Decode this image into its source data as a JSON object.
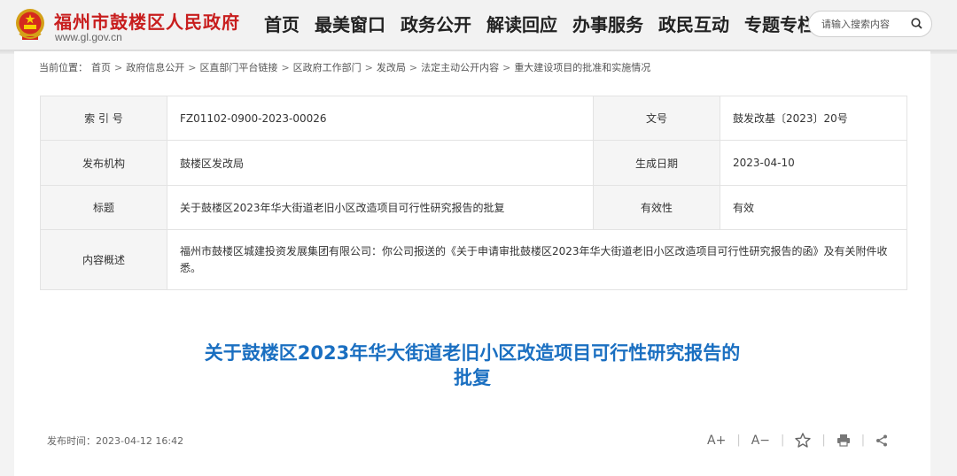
{
  "site": {
    "title": "福州市鼓楼区人民政府",
    "url": "www.gl.gov.cn"
  },
  "nav": [
    {
      "label": "首页"
    },
    {
      "label": "最美窗口"
    },
    {
      "label": "政务公开"
    },
    {
      "label": "解读回应"
    },
    {
      "label": "办事服务"
    },
    {
      "label": "政民互动"
    },
    {
      "label": "专题专栏"
    }
  ],
  "search": {
    "placeholder": "请输入搜索内容",
    "icon": "search-icon"
  },
  "breadcrumb": {
    "prefix": "当前位置：",
    "items": [
      "首页",
      "政府信息公开",
      "区直部门平台链接",
      "区政府工作部门",
      "发改局",
      "法定主动公开内容",
      "重大建设项目的批准和实施情况"
    ],
    "separator": ">"
  },
  "meta": {
    "index_label": "索 引 号",
    "index_value": "FZ01102-0900-2023-00026",
    "docno_label": "文号",
    "docno_value": "鼓发改基〔2023〕20号",
    "publisher_label": "发布机构",
    "publisher_value": "鼓楼区发改局",
    "date_label": "生成日期",
    "date_value": "2023-04-10",
    "title_label": "标题",
    "title_value": "关于鼓楼区2023年华大街道老旧小区改造项目可行性研究报告的批复",
    "validity_label": "有效性",
    "validity_value": "有效",
    "summary_label": "内容概述",
    "summary_value": "福州市鼓楼区城建投资发展集团有限公司：你公司报送的《关于申请审批鼓楼区2023年华大街道老旧小区改造项目可行性研究报告的函》及有关附件收悉。"
  },
  "document": {
    "title_line1": "关于鼓楼区2023年华大街道老旧小区改造项目可行性研究报告的",
    "title_line2": "批复",
    "publish_label": "发布时间：",
    "publish_time": "2023-04-12 16:42"
  },
  "tools": {
    "font_increase": "A+",
    "font_decrease": "A−",
    "favorite_icon": "star-icon",
    "print_icon": "printer-icon",
    "share_icon": "share-icon"
  },
  "colors": {
    "brand_red": "#c81e1e",
    "title_blue": "#1a6fc1"
  }
}
